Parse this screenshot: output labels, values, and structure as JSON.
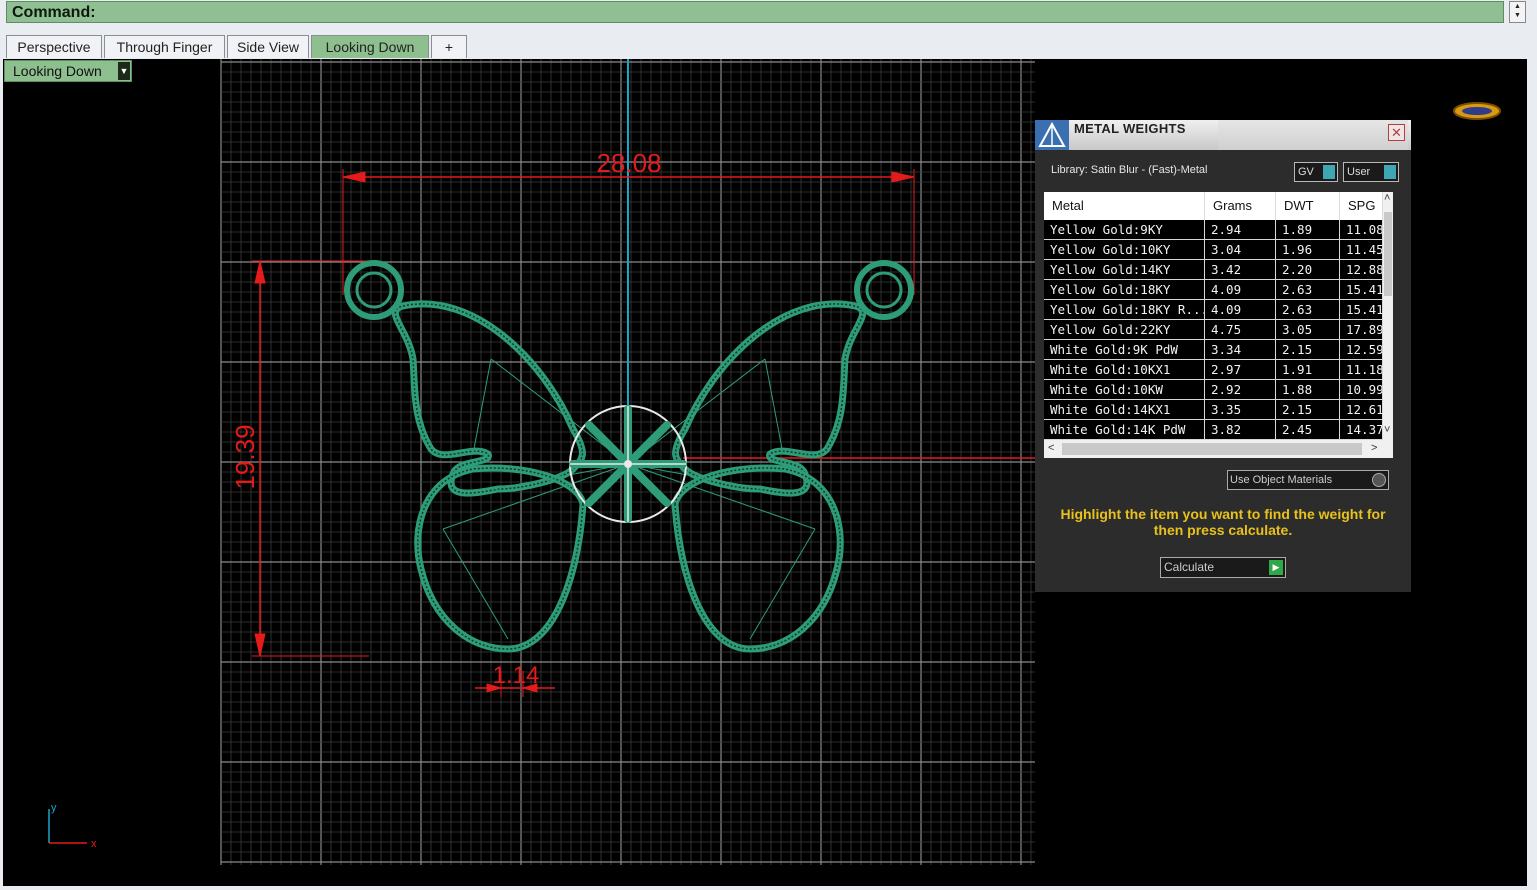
{
  "command": {
    "label": "Command:"
  },
  "tabs": [
    {
      "label": "Perspective",
      "active": false
    },
    {
      "label": "Through Finger",
      "active": false
    },
    {
      "label": "Side View",
      "active": false
    },
    {
      "label": "Looking Down",
      "active": true
    },
    {
      "label": "+",
      "active": false
    }
  ],
  "viewport": {
    "name": "Looking Down",
    "dimensions": {
      "width": "28.08",
      "height": "19.39",
      "thickness": "1.14"
    },
    "axes": {
      "y": "y",
      "x": "x"
    },
    "colors": {
      "grid": "#5a5a5a",
      "model": "#2e9c78",
      "dimension": "#e31b1b",
      "axis": "#1aa6c8",
      "background": "#000000"
    }
  },
  "metal_weights": {
    "title": "METAL WEIGHTS",
    "library": "Library: Satin Blur - (Fast)-Metal",
    "toggles": [
      {
        "label": "GV"
      },
      {
        "label": "User"
      }
    ],
    "columns": [
      "Metal",
      "Grams",
      "DWT",
      "SPG"
    ],
    "rows": [
      [
        "Yellow Gold:9KY",
        "2.94",
        "1.89",
        "11.08"
      ],
      [
        "Yellow Gold:10KY",
        "3.04",
        "1.96",
        "11.45"
      ],
      [
        "Yellow Gold:14KY",
        "3.42",
        "2.20",
        "12.88"
      ],
      [
        "Yellow Gold:18KY",
        "4.09",
        "2.63",
        "15.41"
      ],
      [
        "Yellow Gold:18KY R...",
        "4.09",
        "2.63",
        "15.41"
      ],
      [
        "Yellow Gold:22KY",
        "4.75",
        "3.05",
        "17.89"
      ],
      [
        "White Gold:9K PdW",
        "3.34",
        "2.15",
        "12.59"
      ],
      [
        "White Gold:10KX1",
        "2.97",
        "1.91",
        "11.18"
      ],
      [
        "White Gold:10KW",
        "2.92",
        "1.88",
        "10.99"
      ],
      [
        "White Gold:14KX1",
        "3.35",
        "2.15",
        "12.61"
      ],
      [
        "White Gold:14K PdW",
        "3.82",
        "2.45",
        "14.37"
      ]
    ],
    "use_object_materials": "Use Object Materials",
    "hint": "Highlight the item you want to find the weight for then press calculate.",
    "calculate": "Calculate",
    "colors": {
      "hint": "#e8c21a",
      "toggle": "#3fa7b3",
      "go": "#2fa84a"
    }
  }
}
